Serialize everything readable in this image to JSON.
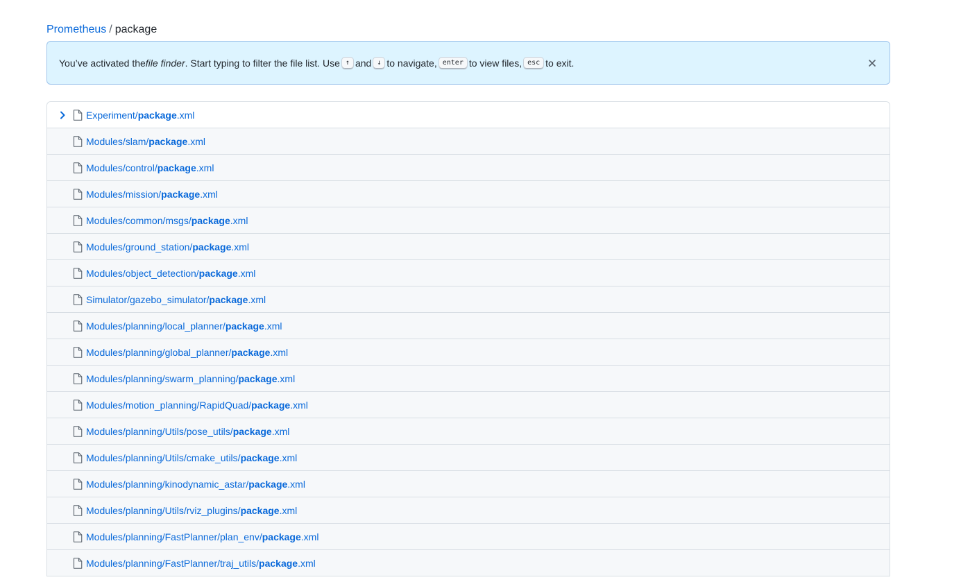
{
  "breadcrumb": {
    "repo": "Prometheus",
    "separator": "/",
    "query": "package"
  },
  "flash": {
    "text_1": "You’ve activated the ",
    "text_finder": "file finder",
    "text_2": ". Start typing to filter the file list. Use ",
    "key_up": "↑",
    "text_and": " and ",
    "key_down": "↓",
    "text_3": " to navigate, ",
    "key_enter": "enter",
    "text_4": " to view files, ",
    "key_esc": "esc",
    "text_5": " to exit."
  },
  "files": [
    {
      "prefix": "Experiment/",
      "match": "package",
      "suffix": ".xml"
    },
    {
      "prefix": "Modules/slam/",
      "match": "package",
      "suffix": ".xml"
    },
    {
      "prefix": "Modules/control/",
      "match": "package",
      "suffix": ".xml"
    },
    {
      "prefix": "Modules/mission/",
      "match": "package",
      "suffix": ".xml"
    },
    {
      "prefix": "Modules/common/msgs/",
      "match": "package",
      "suffix": ".xml"
    },
    {
      "prefix": "Modules/ground_station/",
      "match": "package",
      "suffix": ".xml"
    },
    {
      "prefix": "Modules/object_detection/",
      "match": "package",
      "suffix": ".xml"
    },
    {
      "prefix": "Simulator/gazebo_simulator/",
      "match": "package",
      "suffix": ".xml"
    },
    {
      "prefix": "Modules/planning/local_planner/",
      "match": "package",
      "suffix": ".xml"
    },
    {
      "prefix": "Modules/planning/global_planner/",
      "match": "package",
      "suffix": ".xml"
    },
    {
      "prefix": "Modules/planning/swarm_planning/",
      "match": "package",
      "suffix": ".xml"
    },
    {
      "prefix": "Modules/motion_planning/RapidQuad/",
      "match": "package",
      "suffix": ".xml"
    },
    {
      "prefix": "Modules/planning/Utils/pose_utils/",
      "match": "package",
      "suffix": ".xml"
    },
    {
      "prefix": "Modules/planning/Utils/cmake_utils/",
      "match": "package",
      "suffix": ".xml"
    },
    {
      "prefix": "Modules/planning/kinodynamic_astar/",
      "match": "package",
      "suffix": ".xml"
    },
    {
      "prefix": "Modules/planning/Utils/rviz_plugins/",
      "match": "package",
      "suffix": ".xml"
    },
    {
      "prefix": "Modules/planning/FastPlanner/plan_env/",
      "match": "package",
      "suffix": ".xml"
    },
    {
      "prefix": "Modules/planning/FastPlanner/traj_utils/",
      "match": "package",
      "suffix": ".xml"
    }
  ],
  "icons": {
    "selected_row": "chevron-right-icon",
    "file": "file-icon",
    "close": "close-icon"
  },
  "colors": {
    "link": "#0969da",
    "flash_bg": "#ddf4ff",
    "flash_border": "#9fc4ec",
    "row_bg": "#f6f8fa",
    "border": "#d8dee4"
  }
}
